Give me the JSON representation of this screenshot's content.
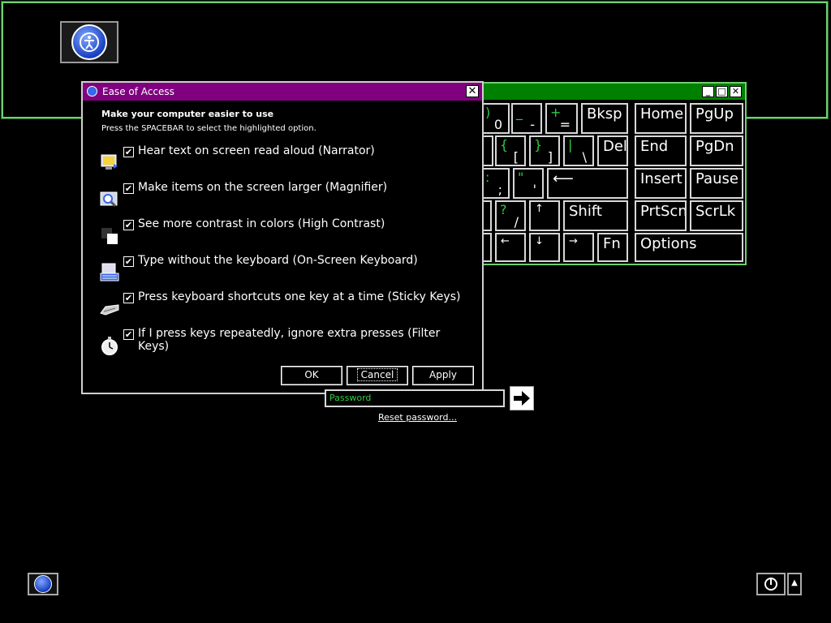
{
  "dialog": {
    "title": "Ease of Access",
    "close_label": "✕",
    "heading": "Make your computer easier to use",
    "subheading": "Press the SPACEBAR to select the highlighted option.",
    "options": [
      {
        "label": "Hear text on screen read aloud (Narrator)",
        "checked": true,
        "icon": "narrator-icon"
      },
      {
        "label": "Make items on the screen larger (Magnifier)",
        "checked": true,
        "icon": "magnifier-icon"
      },
      {
        "label": "See more contrast in colors (High Contrast)",
        "checked": true,
        "icon": "high-contrast-icon"
      },
      {
        "label": "Type without the keyboard (On-Screen Keyboard)",
        "checked": true,
        "icon": "on-screen-keyboard-icon"
      },
      {
        "label": "Press keyboard shortcuts one key at a time (Sticky Keys)",
        "checked": true,
        "icon": "sticky-keys-icon"
      },
      {
        "label": "If I press keys repeatedly, ignore extra presses (Filter Keys)",
        "checked": true,
        "icon": "filter-keys-icon"
      }
    ],
    "buttons": {
      "ok": "OK",
      "cancel": "Cancel",
      "apply": "Apply"
    }
  },
  "keyboard": {
    "title_buttons": [
      "_",
      "□",
      "✕"
    ],
    "keys": {
      "k0": {
        "top": ")",
        "bottom": "0"
      },
      "kminus": {
        "top": "_",
        "bottom": "-"
      },
      "kplus": {
        "top": "+",
        "bottom": "="
      },
      "bksp": "Bksp",
      "home": "Home",
      "pgup": "PgUp",
      "kbrace": {
        "top": "{",
        "bottom": "["
      },
      "kbrace2": {
        "top": "}",
        "bottom": "]"
      },
      "kpipe": {
        "top": "|",
        "bottom": "\\"
      },
      "del": "Del",
      "end": "End",
      "pgdn": "PgDn",
      "kcolon": {
        "top": ":",
        "bottom": ";"
      },
      "kquote": {
        "top": "\"",
        "bottom": "'"
      },
      "enter": "⟵",
      "insert": "Insert",
      "pause": "Pause",
      "kslash": {
        "top": "?",
        "bottom": "/"
      },
      "up": "↑",
      "shift": "Shift",
      "prtscn": "PrtScn",
      "scrlk": "ScrLk",
      "left": "←",
      "down": "↓",
      "right": "→",
      "fn": "Fn",
      "options": "Options"
    }
  },
  "login": {
    "password_placeholder": "Password",
    "reset_link": "Reset password..."
  },
  "colors": {
    "dialog_title_bg": "#800080",
    "keyboard_title_bg": "#008000",
    "accent_green": "#2ecc40"
  }
}
